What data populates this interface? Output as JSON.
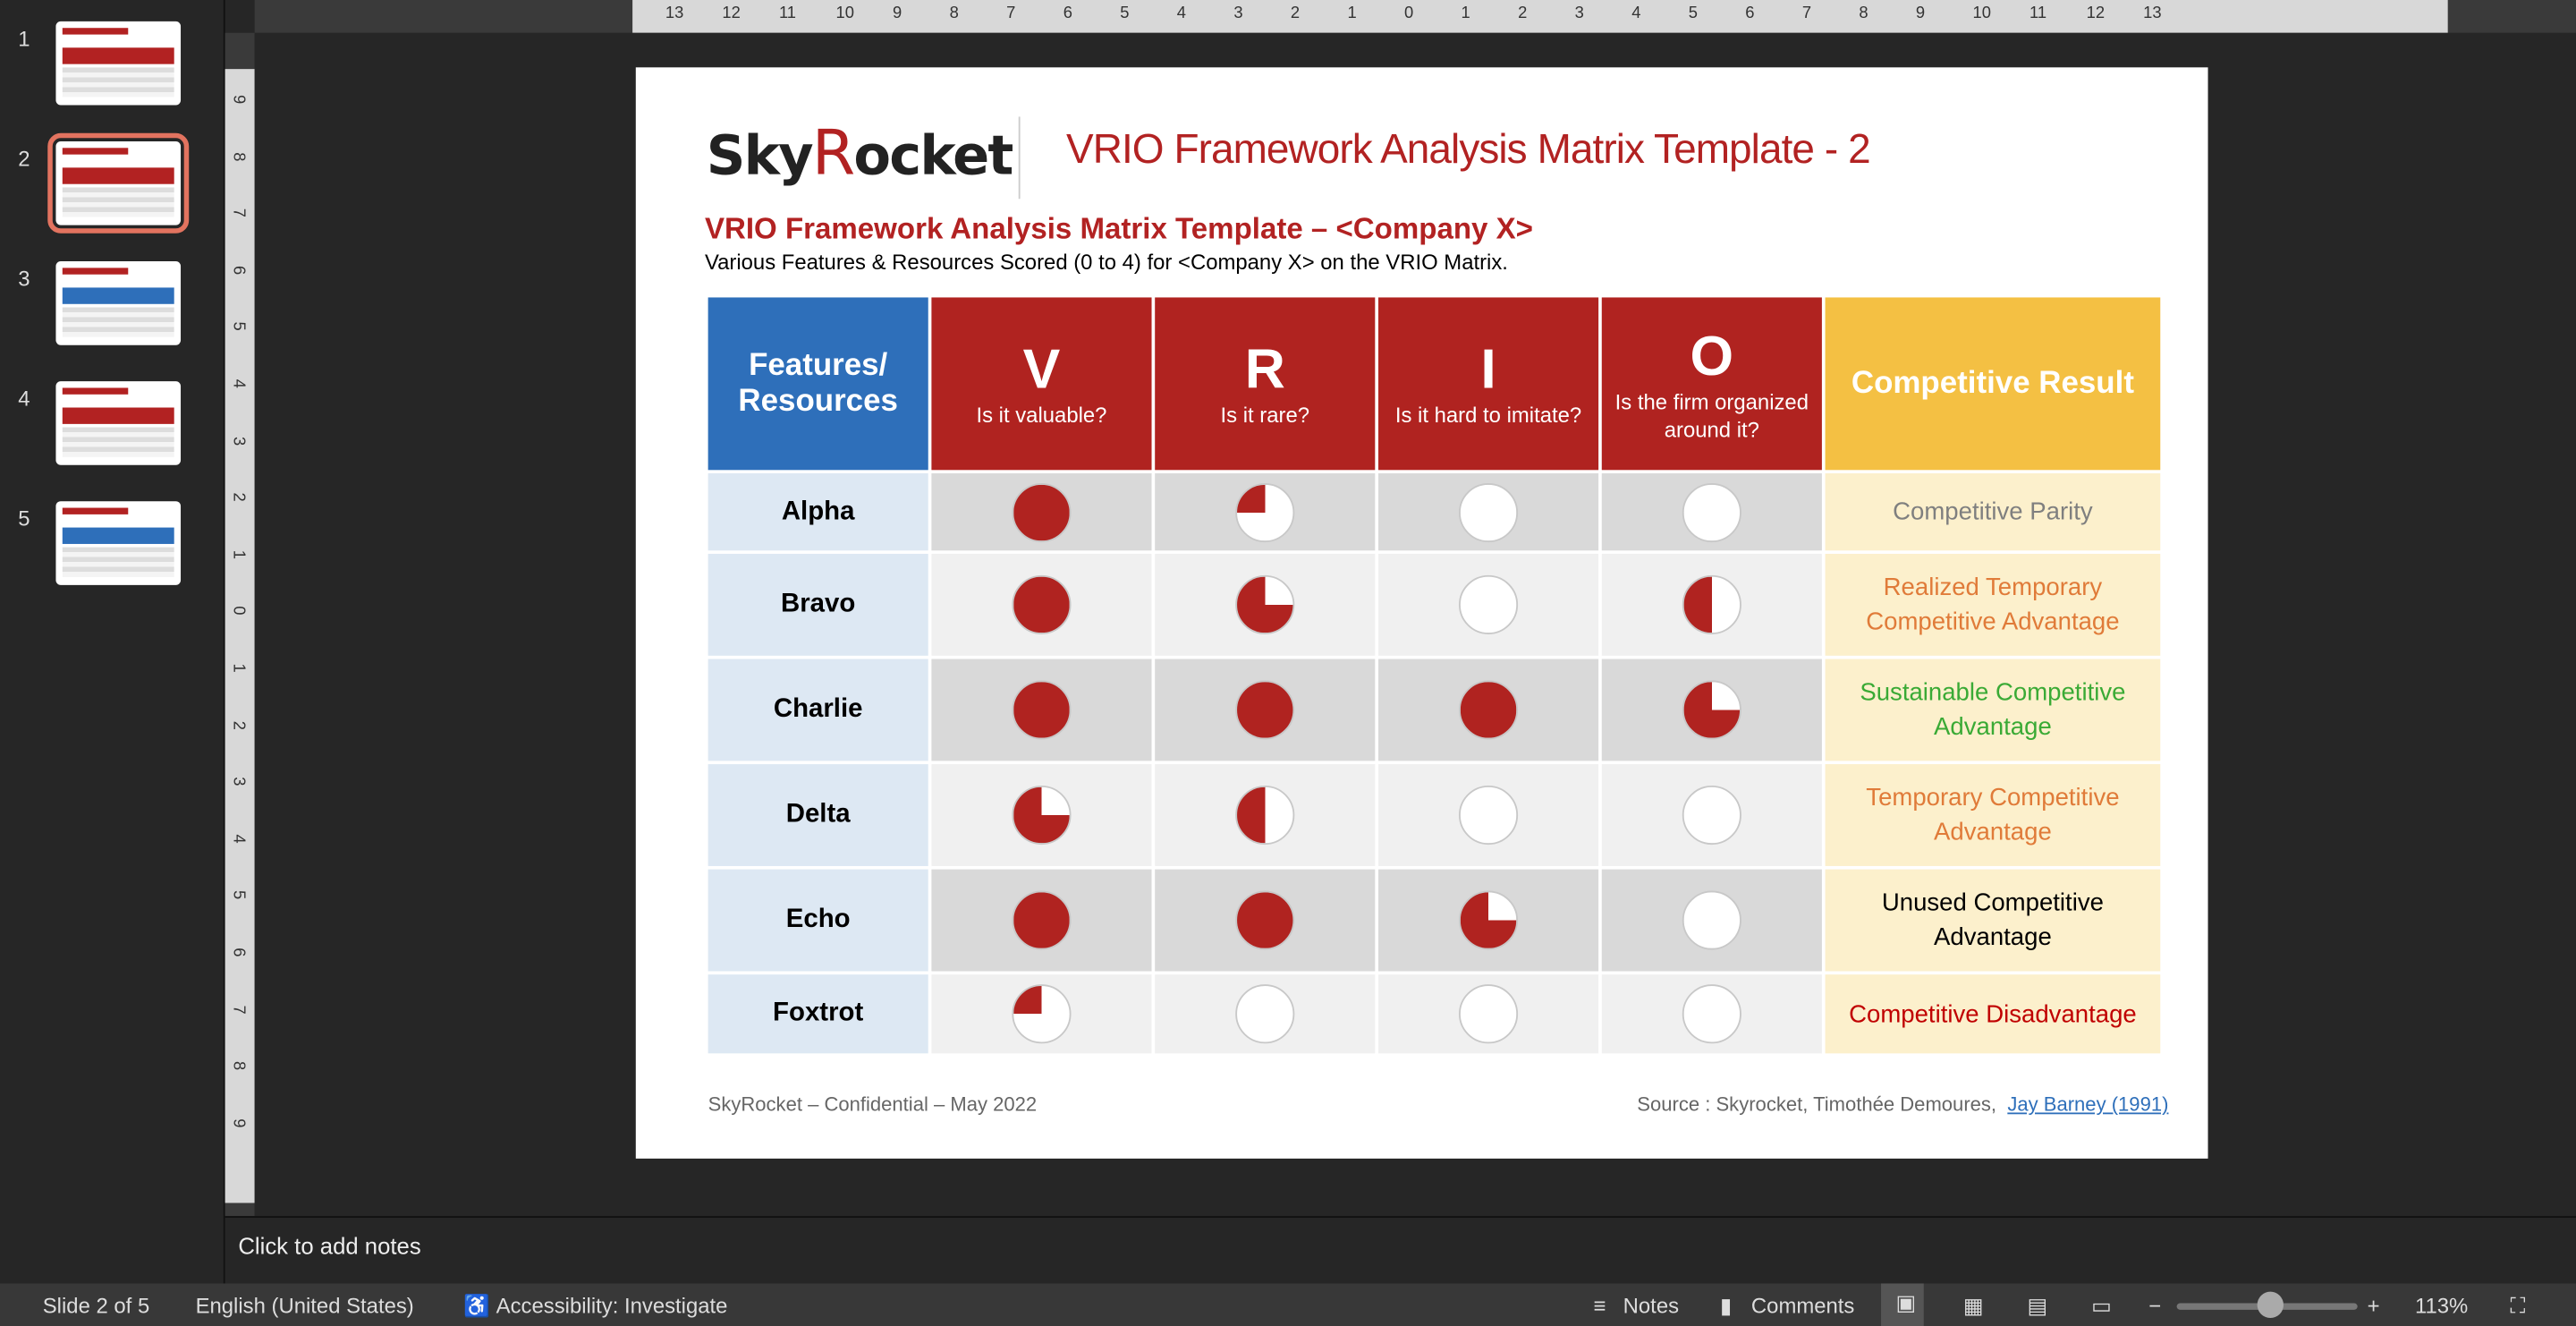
{
  "thumbnails": [
    {
      "number": "1"
    },
    {
      "number": "2",
      "selected": true
    },
    {
      "number": "3"
    },
    {
      "number": "4"
    },
    {
      "number": "5"
    }
  ],
  "slide": {
    "logo": {
      "text": "SkyRocket",
      "pre": "Sky",
      "r": "R",
      "post": "ocket"
    },
    "title": "VRIO Framework Analysis Matrix Template - 2",
    "heading": "VRIO Framework Analysis Matrix Template – <Company X>",
    "subheading": "Various Features & Resources Scored (0 to 4) for <Company X> on the VRIO Matrix.",
    "table": {
      "features_header": "Features/ Resources",
      "result_header": "Competitive Result",
      "columns": [
        {
          "letter": "V",
          "question": "Is it valuable?"
        },
        {
          "letter": "R",
          "question": "Is it rare?"
        },
        {
          "letter": "I",
          "question": "Is it hard to imitate?"
        },
        {
          "letter": "O",
          "question": "Is the firm organized around it?"
        }
      ],
      "rows": [
        {
          "name": "Alpha",
          "scores": [
            4,
            1,
            0,
            0
          ],
          "result": "Competitive Parity",
          "result_color": "#7f7f7f"
        },
        {
          "name": "Bravo",
          "scores": [
            4,
            3,
            0,
            2
          ],
          "result": "Realized Temporary Competitive Advantage",
          "result_color": "#e07b39"
        },
        {
          "name": "Charlie",
          "scores": [
            4,
            4,
            4,
            3
          ],
          "result": "Sustainable Competitive Advantage",
          "result_color": "#3aaa35"
        },
        {
          "name": "Delta",
          "scores": [
            3,
            2,
            0,
            0
          ],
          "result": "Temporary Competitive Advantage",
          "result_color": "#e07b39"
        },
        {
          "name": "Echo",
          "scores": [
            4,
            4,
            3,
            0
          ],
          "result": "Unused Competitive Advantage",
          "result_color": "#000000"
        },
        {
          "name": "Foxtrot",
          "scores": [
            1,
            0,
            0,
            0
          ],
          "result": "Competitive Disadvantage",
          "result_color": "#c00000"
        }
      ],
      "score_max": 4,
      "fill_color": "#b02320"
    },
    "footer_left": "SkyRocket – Confidential – May 2022",
    "footer_source": "Source : Skyrocket, Timothée Demoures,",
    "footer_link": "Jay Barney (1991)"
  },
  "ruler_top_labels": [
    "13",
    "12",
    "11",
    "10",
    "9",
    "8",
    "7",
    "6",
    "5",
    "4",
    "3",
    "2",
    "1",
    "0",
    "1",
    "2",
    "3",
    "4",
    "5",
    "6",
    "7",
    "8",
    "9",
    "10",
    "11",
    "12",
    "13"
  ],
  "ruler_left_labels": [
    "9",
    "8",
    "7",
    "6",
    "5",
    "4",
    "3",
    "2",
    "1",
    "0",
    "1",
    "2",
    "3",
    "4",
    "5",
    "6",
    "7",
    "8",
    "9"
  ],
  "notes_placeholder": "Click to add notes",
  "status": {
    "slide": "Slide 2 of 5",
    "language": "English (United States)",
    "accessibility": "Accessibility: Investigate",
    "notes": "Notes",
    "comments": "Comments",
    "zoom": "113%",
    "zoom_level": 0.52
  }
}
